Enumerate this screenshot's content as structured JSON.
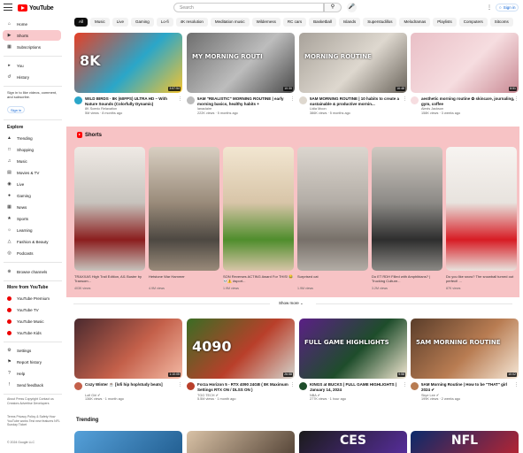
{
  "topbar": {
    "logo_text": "YouTube",
    "search_placeholder": "Search",
    "signin": "Sign in"
  },
  "sidebar": {
    "main": [
      {
        "label": "Home",
        "icon": "home-icon"
      },
      {
        "label": "Shorts",
        "icon": "shorts-icon"
      },
      {
        "label": "Subscriptions",
        "icon": "subscriptions-icon"
      }
    ],
    "you": [
      {
        "label": "You",
        "icon": "you-icon"
      },
      {
        "label": "History",
        "icon": "history-icon"
      }
    ],
    "signin_note": "Sign in to like videos, comment, and subscribe.",
    "signin_label": "Sign in",
    "explore_title": "Explore",
    "explore": [
      {
        "label": "Trending"
      },
      {
        "label": "Shopping"
      },
      {
        "label": "Music"
      },
      {
        "label": "Movies & TV"
      },
      {
        "label": "Live"
      },
      {
        "label": "Gaming"
      },
      {
        "label": "News"
      },
      {
        "label": "Sports"
      },
      {
        "label": "Learning"
      },
      {
        "label": "Fashion & Beauty"
      },
      {
        "label": "Podcasts"
      }
    ],
    "browse": "Browse channels",
    "more_title": "More from YouTube",
    "more": [
      {
        "label": "YouTube Premium"
      },
      {
        "label": "YouTube TV"
      },
      {
        "label": "YouTube Music"
      },
      {
        "label": "YouTube Kids"
      }
    ],
    "settings": [
      {
        "label": "Settings"
      },
      {
        "label": "Report history"
      },
      {
        "label": "Help"
      },
      {
        "label": "Send feedback"
      }
    ],
    "footer1": "About  Press  Copyright Contact us  Creators  Advertise Developers",
    "footer2": "Terms  Privacy  Policy & Safety How YouTube works Test new features NFL Sunday Ticket",
    "footer3": "© 2024 Google LLC"
  },
  "chips": [
    "All",
    "Music",
    "Live",
    "Gaming",
    "Lo-fi",
    "4K resolution",
    "Meditation music",
    "Wilderness",
    "RC cars",
    "Basketball",
    "Islands",
    "Superstudillos",
    "Melodramas",
    "Playlists",
    "Computers",
    "Sitcoms"
  ],
  "videos_row1": [
    {
      "title": "WILD BIRDS · 8K (60FPS) ULTRA HD – With Nature Sounds (Colorfully Dynamic)",
      "channel": "8K Scenic Relaxation",
      "meta": "5M views · 8 months ago",
      "duration": "3:57:54",
      "thumb_text": "8K",
      "colors": [
        "#e63f26",
        "#2aa6c9",
        "#f4c430"
      ]
    },
    {
      "title": "5AM \"REALISTIC\" MORNING ROUTINE | early morning basics, healthy habits +",
      "channel": "lanaclaire",
      "meta": "222K views · 5 months ago",
      "duration": "10:30",
      "thumb_text": "MY MORNING ROUTI",
      "colors": [
        "#6e6e6e",
        "#bdbdbd",
        "#4a4a4a"
      ]
    },
    {
      "title": "5AM MORNING ROUTINE | 10 habits to create a sustainable & productive mornin...",
      "channel": "Lidia Moon",
      "meta": "386K views · 5 months ago",
      "duration": "16:48",
      "thumb_text": "MORNING ROUTINE",
      "colors": [
        "#a8a29a",
        "#ded8cf",
        "#6b655c"
      ]
    },
    {
      "title": "aesthetic morning routine ✿ skincare, journaling, gym, coffee",
      "channel": "Alexis Jackson",
      "meta": "158K views · 3 weeks ago",
      "duration": "8:51",
      "thumb_text": "",
      "colors": [
        "#e9bfc6",
        "#f6dde0",
        "#c98a94"
      ]
    }
  ],
  "shorts": {
    "title": "Shorts",
    "items": [
      {
        "title": "TRAXXAS High Trail Edition, AI1 Buster by Transom...",
        "meta": "403K views",
        "colors": [
          "#c7c3bd",
          "#8b1e1e",
          "#efeae5"
        ]
      },
      {
        "title": "Hetstone War Hammer",
        "meta": "4.9M views",
        "colors": [
          "#9a8b7a",
          "#4d4842",
          "#d9cfc2"
        ]
      },
      {
        "title": "SON Reverses ACTING Award For THIS! 😂💀⚠️ #sport...",
        "meta": "1.9M views",
        "colors": [
          "#d8c5a8",
          "#4f8d2c",
          "#f2e6d1"
        ]
      },
      {
        "title": "Surprised cat",
        "meta": "1.9M views",
        "colors": [
          "#b3ada6",
          "#777069",
          "#dcd6cf"
        ]
      },
      {
        "title": "Do ET RDH Filled with Amphibians? | Trucking Culture...",
        "meta": "3.2M views",
        "colors": [
          "#8c8a86",
          "#2e2e2e",
          "#cfc9c1"
        ]
      },
      {
        "title": "Do you like snow? The snowball turned out perfect! ...",
        "meta": "87K views",
        "colors": [
          "#e8e3de",
          "#d71c24",
          "#f7f4f1"
        ]
      }
    ],
    "show_more": "Show more ⌄"
  },
  "videos_row2": [
    {
      "title": "Cozy Winter ☕ [lofi hip hop/study beats]",
      "channel": "Lofi Girl ✔",
      "meta": "136K views · 1 month ago",
      "duration": "1:10:05",
      "thumb_text": "",
      "colors": [
        "#4a2a2f",
        "#c4604a",
        "#f3b9a4"
      ]
    },
    {
      "title": "Forza Horizon 5 - RTX 4090 24GB ( 8K Maximum Settings RTX ON / DLSS ON )",
      "channel": "TGG TECH ✔",
      "meta": "5.5M views · 1 month ago",
      "duration": "26:58",
      "thumb_text": "4090",
      "colors": [
        "#3a6d24",
        "#b93f2a",
        "#d3d3cc"
      ]
    },
    {
      "title": "KINGS at BUCKS | FULL GAME HIGHLIGHTS | January 14, 2024",
      "channel": "NBA ✔",
      "meta": "277K views · 1 hour ago",
      "duration": "9:58",
      "thumb_text": "FULL GAME HIGHLIGHTS",
      "colors": [
        "#5b1f86",
        "#1e4d2b",
        "#f1e6d1"
      ]
    },
    {
      "title": "5AM Morning Routine | How to be \"THAT\" girl 2024 ✔",
      "channel": "Skye Lee ✔",
      "meta": "199K views · 2 weeks ago",
      "duration": "10:02",
      "thumb_text": "5AM MORNING ROUTINE",
      "colors": [
        "#5a3d2a",
        "#b87c52",
        "#f5e7d6"
      ]
    }
  ],
  "trending": {
    "title": "Trending",
    "items": [
      {
        "thumb_text": "",
        "colors": [
          "#55a0d9",
          "#1f5a8c"
        ]
      },
      {
        "thumb_text": "",
        "colors": [
          "#d9c2a6",
          "#4b3b2f"
        ]
      },
      {
        "thumb_text": "CES",
        "colors": [
          "#1b1b1b",
          "#5c2fa6"
        ]
      },
      {
        "thumb_text": "NFL",
        "colors": [
          "#0b2a6b",
          "#c2242f"
        ]
      }
    ]
  }
}
